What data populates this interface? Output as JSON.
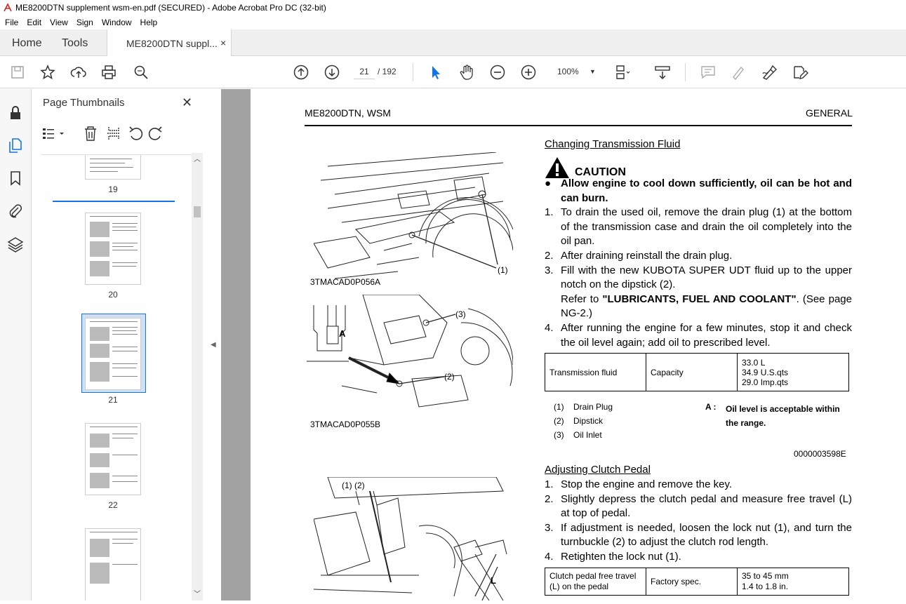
{
  "window": {
    "title": "ME8200DTN supplement wsm-en.pdf (SECURED) - Adobe Acrobat Pro DC (32-bit)"
  },
  "menu": [
    "File",
    "Edit",
    "View",
    "Sign",
    "Window",
    "Help"
  ],
  "tabs": {
    "home": "Home",
    "tools": "Tools",
    "document": "ME8200DTN suppl...",
    "close": "×"
  },
  "toolbar": {
    "page_current": "21",
    "page_total": "/ 192",
    "zoom": "100%"
  },
  "panel": {
    "title": "Page Thumbnails",
    "close": "✕",
    "thumbnails": [
      {
        "label": "19"
      },
      {
        "label": "20"
      },
      {
        "label": "21",
        "selected": true
      },
      {
        "label": "22"
      },
      {
        "label": ""
      }
    ]
  },
  "page": {
    "header_left": "ME8200DTN, WSM",
    "header_right": "GENERAL",
    "section1": {
      "title": "Changing Transmission Fluid",
      "caution_word": "CAUTION",
      "caution_text": "Allow engine to cool down sufficiently, oil can be hot and can burn.",
      "steps": [
        {
          "n": "1.",
          "text": "To drain the used oil, remove the drain plug (1) at the bottom of the transmission case and drain the oil completely into the oil pan."
        },
        {
          "n": "2.",
          "text": "After draining reinstall the drain plug."
        },
        {
          "n": "3.",
          "text": "Fill with the new KUBOTA SUPER UDT fluid up to the upper notch on the dipstick (2)."
        },
        {
          "n": "",
          "pre": "Refer to ",
          "bold": "\"LUBRICANTS, FUEL AND COOLANT\"",
          "post": ". (See page NG-2.)"
        },
        {
          "n": "4.",
          "text": "After running the engine for a few minutes, stop it and check the oil level again; add oil to prescribed level."
        }
      ],
      "table": {
        "c1": "Transmission fluid",
        "c2": "Capacity",
        "v1": "33.0 L",
        "v2": "34.9 U.S.qts",
        "v3": "29.0 Imp.qts"
      },
      "legend": [
        {
          "n": "(1)",
          "label": "Drain Plug"
        },
        {
          "n": "(2)",
          "label": "Dipstick"
        },
        {
          "n": "(3)",
          "label": "Oil Inlet"
        }
      ],
      "note_key": "A :",
      "note_text": "Oil level is acceptable within the range.",
      "code": "0000003598E",
      "fig1_caption": "3TMACAD0P056A",
      "fig2_caption": "3TMACAD0P055B",
      "fig1_callout": "(1)",
      "fig2_callout_3": "(3)",
      "fig2_callout_2": "(2)",
      "fig2_callout_a": "A"
    },
    "section2": {
      "title": "Adjusting Clutch Pedal",
      "steps": [
        {
          "n": "1.",
          "text": "Stop the engine and remove the key."
        },
        {
          "n": "2.",
          "text": "Slightly depress the clutch pedal and measure free travel (L) at top of pedal."
        },
        {
          "n": "3.",
          "text": "If adjustment is needed, loosen the lock nut (1), and turn the turnbuckle (2) to adjust the clutch rod length."
        },
        {
          "n": "4.",
          "text": "Retighten the lock nut (1)."
        }
      ],
      "table": {
        "c1a": "Clutch pedal free travel",
        "c1b": "(L) on the pedal",
        "c2": "Factory spec.",
        "v1": "35 to 45 mm",
        "v2": "1.4 to 1.8 in."
      },
      "fig3_callout": "(1) (2)",
      "fig3_callout_l": "L"
    }
  }
}
